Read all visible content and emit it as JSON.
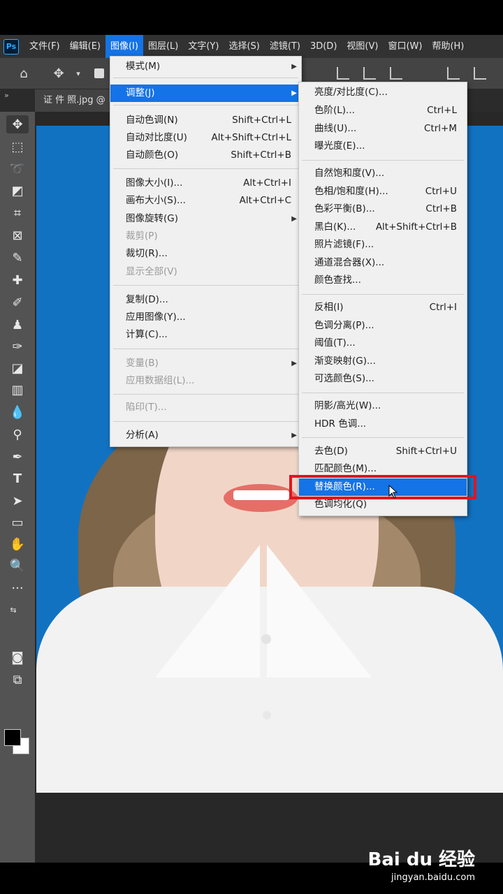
{
  "menubar": {
    "logo": "Ps",
    "items": [
      "文件(F)",
      "编辑(E)",
      "图像(I)",
      "图层(L)",
      "文字(Y)",
      "选择(S)",
      "滤镜(T)",
      "3D(D)",
      "视图(V)",
      "窗口(W)",
      "帮助(H)"
    ],
    "active_index": 2
  },
  "document_tab": {
    "title": "证 件 照.jpg @"
  },
  "image_menu": {
    "items": [
      {
        "label": "模式(M)",
        "shortcut": "",
        "submenu": true,
        "disabled": false
      },
      {
        "label": "调整(J)",
        "shortcut": "",
        "submenu": true,
        "disabled": false,
        "highlighted": true
      },
      {
        "label": "自动色调(N)",
        "shortcut": "Shift+Ctrl+L",
        "disabled": false
      },
      {
        "label": "自动对比度(U)",
        "shortcut": "Alt+Shift+Ctrl+L",
        "disabled": false
      },
      {
        "label": "自动颜色(O)",
        "shortcut": "Shift+Ctrl+B",
        "disabled": false
      },
      {
        "label": "图像大小(I)...",
        "shortcut": "Alt+Ctrl+I",
        "disabled": false
      },
      {
        "label": "画布大小(S)...",
        "shortcut": "Alt+Ctrl+C",
        "disabled": false
      },
      {
        "label": "图像旋转(G)",
        "shortcut": "",
        "submenu": true,
        "disabled": false
      },
      {
        "label": "裁剪(P)",
        "shortcut": "",
        "disabled": true
      },
      {
        "label": "裁切(R)...",
        "shortcut": "",
        "disabled": false
      },
      {
        "label": "显示全部(V)",
        "shortcut": "",
        "disabled": true
      },
      {
        "label": "复制(D)...",
        "shortcut": "",
        "disabled": false
      },
      {
        "label": "应用图像(Y)...",
        "shortcut": "",
        "disabled": false
      },
      {
        "label": "计算(C)...",
        "shortcut": "",
        "disabled": false
      },
      {
        "label": "变量(B)",
        "shortcut": "",
        "submenu": true,
        "disabled": true
      },
      {
        "label": "应用数据组(L)...",
        "shortcut": "",
        "disabled": true
      },
      {
        "label": "陷印(T)...",
        "shortcut": "",
        "disabled": true
      },
      {
        "label": "分析(A)",
        "shortcut": "",
        "submenu": true,
        "disabled": false
      }
    ]
  },
  "adjust_submenu": {
    "items": [
      {
        "label": "亮度/对比度(C)...",
        "shortcut": ""
      },
      {
        "label": "色阶(L)...",
        "shortcut": "Ctrl+L"
      },
      {
        "label": "曲线(U)...",
        "shortcut": "Ctrl+M"
      },
      {
        "label": "曝光度(E)...",
        "shortcut": ""
      },
      {
        "label": "自然饱和度(V)...",
        "shortcut": ""
      },
      {
        "label": "色相/饱和度(H)...",
        "shortcut": "Ctrl+U"
      },
      {
        "label": "色彩平衡(B)...",
        "shortcut": "Ctrl+B"
      },
      {
        "label": "黑白(K)...",
        "shortcut": "Alt+Shift+Ctrl+B"
      },
      {
        "label": "照片滤镜(F)...",
        "shortcut": ""
      },
      {
        "label": "通道混合器(X)...",
        "shortcut": ""
      },
      {
        "label": "颜色查找...",
        "shortcut": ""
      },
      {
        "label": "反相(I)",
        "shortcut": "Ctrl+I"
      },
      {
        "label": "色调分离(P)...",
        "shortcut": ""
      },
      {
        "label": "阈值(T)...",
        "shortcut": ""
      },
      {
        "label": "渐变映射(G)...",
        "shortcut": ""
      },
      {
        "label": "可选颜色(S)...",
        "shortcut": ""
      },
      {
        "label": "阴影/高光(W)...",
        "shortcut": ""
      },
      {
        "label": "HDR 色调...",
        "shortcut": ""
      },
      {
        "label": "去色(D)",
        "shortcut": "Shift+Ctrl+U"
      },
      {
        "label": "匹配颜色(M)...",
        "shortcut": ""
      },
      {
        "label": "替换颜色(R)...",
        "shortcut": "",
        "highlighted": true
      },
      {
        "label": "色调均化(Q)",
        "shortcut": ""
      }
    ]
  },
  "watermark": {
    "brand": "Bai du 经验",
    "url": "jingyan.baidu.com"
  },
  "colors": {
    "accent": "#1473e6",
    "highlight_box": "#e3141b",
    "photo_background": "#1272c2"
  }
}
